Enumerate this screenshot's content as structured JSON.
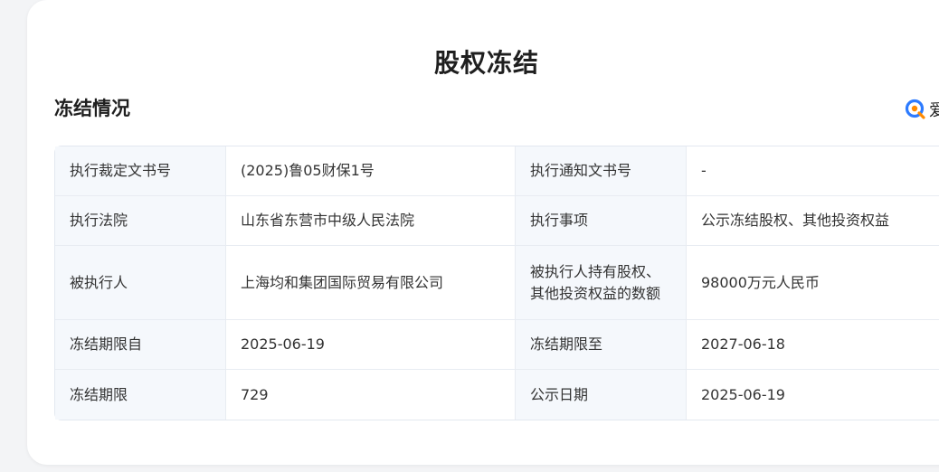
{
  "page_title": "股权冻结",
  "section_title": "冻结情况",
  "brand": {
    "icon": "aiqicha-logo-icon",
    "text_fragment": "爱",
    "accent_colors": [
      "#2d7bff",
      "#ff8a00"
    ]
  },
  "table": {
    "rows": [
      {
        "label1": "执行裁定文书号",
        "value1": "(2025)鲁05财保1号",
        "label2": "执行通知文书号",
        "value2": "-"
      },
      {
        "label1": "执行法院",
        "value1": "山东省东营市中级人民法院",
        "label2": "执行事项",
        "value2": "公示冻结股权、其他投资权益"
      },
      {
        "label1": "被执行人",
        "value1": "上海均和集团国际贸易有限公司",
        "label2": "被执行人持有股权、其他投资权益的数额",
        "value2": "98000万元人民币"
      },
      {
        "label1": "冻结期限自",
        "value1": "2025-06-19",
        "label2": "冻结期限至",
        "value2": "2027-06-18"
      },
      {
        "label1": "冻结期限",
        "value1": "729",
        "label2": "公示日期",
        "value2": "2025-06-19"
      }
    ]
  }
}
